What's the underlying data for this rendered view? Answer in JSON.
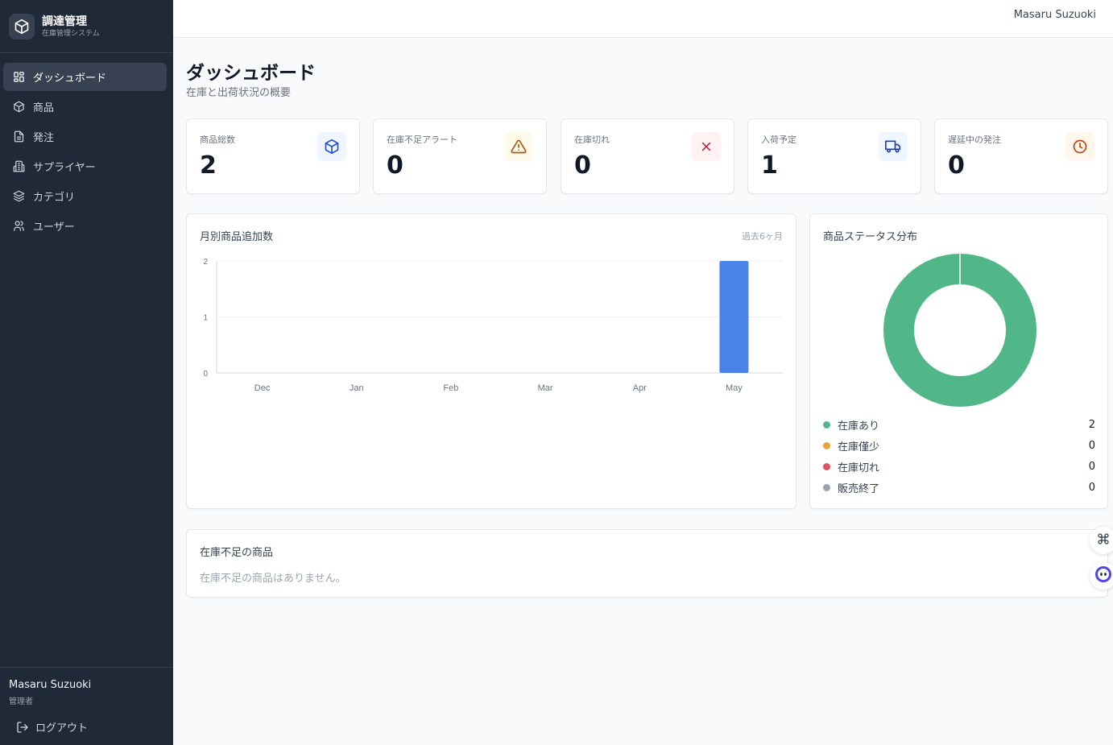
{
  "app": {
    "title": "調達管理",
    "subtitle": "在庫管理システム"
  },
  "sidebar": {
    "items": [
      {
        "label": "ダッシュボード",
        "icon": "dashboard-icon",
        "active": true
      },
      {
        "label": "商品",
        "icon": "box-icon"
      },
      {
        "label": "発注",
        "icon": "document-icon"
      },
      {
        "label": "サプライヤー",
        "icon": "building-icon"
      },
      {
        "label": "カテゴリ",
        "icon": "layers-icon"
      },
      {
        "label": "ユーザー",
        "icon": "users-icon"
      }
    ],
    "user": {
      "name": "Masaru Suzuoki",
      "role": "管理者"
    },
    "logout_label": "ログアウト"
  },
  "topbar": {
    "user_name": "Masaru Suzuoki"
  },
  "page": {
    "title": "ダッシュボード",
    "subtitle": "在庫と出荷状況の概要"
  },
  "stats": [
    {
      "label": "商品総数",
      "value": "2",
      "icon": "box-icon",
      "color": "#1d4ed8",
      "bg": "#eff6ff"
    },
    {
      "label": "在庫不足アラート",
      "value": "0",
      "icon": "warning-icon",
      "color": "#b45309",
      "bg": "#fffbeb"
    },
    {
      "label": "在庫切れ",
      "value": "0",
      "icon": "close-icon",
      "color": "#be123c",
      "bg": "#fef2f2"
    },
    {
      "label": "入荷予定",
      "value": "1",
      "icon": "truck-icon",
      "color": "#1e40af",
      "bg": "#eff6ff"
    },
    {
      "label": "遅延中の発注",
      "value": "0",
      "icon": "clock-icon",
      "color": "#c2410c",
      "bg": "#fff7ed"
    }
  ],
  "monthly_chart": {
    "title": "月別商品追加数",
    "note": "過去6ヶ月"
  },
  "status_chart": {
    "title": "商品ステータス分布",
    "legend": [
      {
        "label": "在庫あり",
        "value": "2",
        "color": "#52b788"
      },
      {
        "label": "在庫僅少",
        "value": "0",
        "color": "#e8a33d"
      },
      {
        "label": "在庫切れ",
        "value": "0",
        "color": "#e05260"
      },
      {
        "label": "販売終了",
        "value": "0",
        "color": "#9ca3af"
      }
    ]
  },
  "low_stock": {
    "title": "在庫不足の商品",
    "empty_message": "在庫不足の商品はありません。"
  },
  "chart_data": [
    {
      "type": "bar",
      "title": "月別商品追加数",
      "categories": [
        "Dec",
        "Jan",
        "Feb",
        "Mar",
        "Apr",
        "May"
      ],
      "values": [
        0,
        0,
        0,
        0,
        0,
        2
      ],
      "yticks": [
        "0",
        "1",
        "2"
      ],
      "ylim": [
        0,
        2
      ],
      "grid": true,
      "color": "#4b82ea"
    },
    {
      "type": "pie",
      "title": "商品ステータス分布",
      "labels": [
        "在庫あり",
        "在庫僅少",
        "在庫切れ",
        "販売終了"
      ],
      "values": [
        2,
        0,
        0,
        0
      ],
      "colors": [
        "#52b788",
        "#e8a33d",
        "#e05260",
        "#9ca3af"
      ]
    }
  ]
}
